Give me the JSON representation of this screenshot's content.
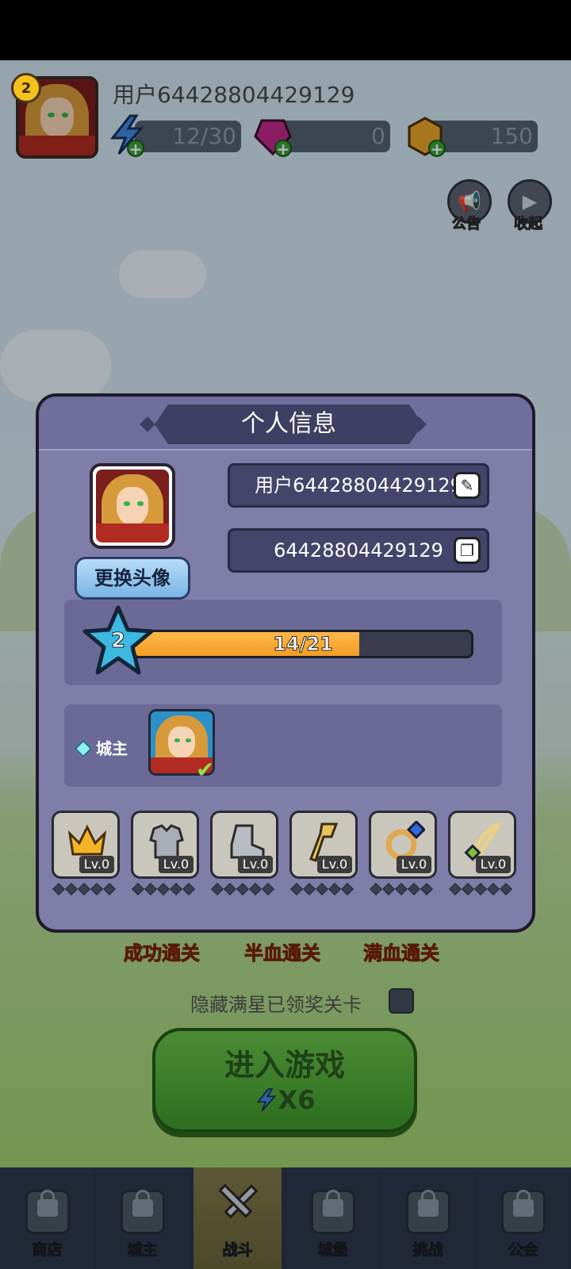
{
  "topbar": {
    "level": "2",
    "username": "用户64428804429129",
    "energy": "12/30",
    "gems": "0",
    "coins": "150",
    "notice_label": "公告",
    "collapse_label": "收起"
  },
  "stage": {
    "modes": [
      "成功通关",
      "半血通关",
      "满血通关"
    ],
    "hide_label": "隐藏满星已领奖关卡",
    "enter_label": "进入游戏",
    "enter_cost": "X6"
  },
  "dialog": {
    "title": "个人信息",
    "change_avatar": "更换头像",
    "name_value": "用户64428804429129",
    "id_value": "64428804429129",
    "level": "2",
    "xp_text": "14/21",
    "xp_fraction": 0.6667,
    "role_label": "城主",
    "equipment": [
      {
        "icon": "crown-icon",
        "level": "Lv.0"
      },
      {
        "icon": "armor-icon",
        "level": "Lv.0"
      },
      {
        "icon": "boot-icon",
        "level": "Lv.0"
      },
      {
        "icon": "staff-icon",
        "level": "Lv.0"
      },
      {
        "icon": "ring-icon",
        "level": "Lv.0"
      },
      {
        "icon": "necklace-icon",
        "level": "Lv.0"
      }
    ]
  },
  "nav": {
    "items": [
      {
        "label": "商店",
        "icon": "shop-lock-icon"
      },
      {
        "label": "城主",
        "icon": "lord-lock-icon"
      },
      {
        "label": "战斗",
        "icon": "battle-swords-icon"
      },
      {
        "label": "城堡",
        "icon": "castle-lock-icon"
      },
      {
        "label": "挑战",
        "icon": "challenge-lock-icon"
      },
      {
        "label": "公会",
        "icon": "guild-lock-icon"
      }
    ],
    "active_index": 2
  },
  "colors": {
    "dialog_bg": "#7f7ea8",
    "xp_fill": "#f29c23",
    "enter_button": "#4fae38"
  }
}
